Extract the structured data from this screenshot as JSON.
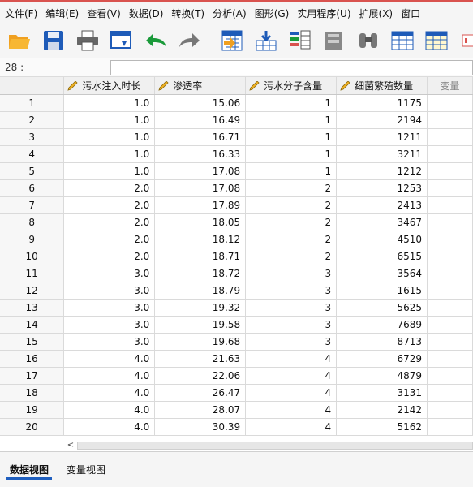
{
  "colors": {
    "accent": "#1f5fbf",
    "toolbar_bg": "#f5f5f5",
    "grid_line": "#dadada",
    "header_bg": "#f0f0f0"
  },
  "menu": {
    "items": [
      "文件(F)",
      "编辑(E)",
      "查看(V)",
      "数据(D)",
      "转换(T)",
      "分析(A)",
      "图形(G)",
      "实用程序(U)",
      "扩展(X)",
      "窗口"
    ]
  },
  "toolbar": {
    "icons": [
      "open-folder-icon",
      "save-icon",
      "print-icon",
      "dialog-recall-icon",
      "undo-icon",
      "redo-icon",
      "goto-case-icon",
      "goto-variable-icon",
      "variables-icon",
      "run-descriptives-icon",
      "find-icon",
      "insert-cases-icon",
      "insert-variable-icon",
      "split-file-icon"
    ]
  },
  "cellbar": {
    "ref": "28 :",
    "value": ""
  },
  "table": {
    "columns": [
      "污水注入时长",
      "渗透率",
      "污水分子含量",
      "细菌繁殖数量",
      "变量"
    ],
    "rows": [
      {
        "n": "1",
        "c1": "1.0",
        "c2": "15.06",
        "c3": "1",
        "c4": "1175"
      },
      {
        "n": "2",
        "c1": "1.0",
        "c2": "16.49",
        "c3": "1",
        "c4": "2194"
      },
      {
        "n": "3",
        "c1": "1.0",
        "c2": "16.71",
        "c3": "1",
        "c4": "1211"
      },
      {
        "n": "4",
        "c1": "1.0",
        "c2": "16.33",
        "c3": "1",
        "c4": "3211"
      },
      {
        "n": "5",
        "c1": "1.0",
        "c2": "17.08",
        "c3": "1",
        "c4": "1212"
      },
      {
        "n": "6",
        "c1": "2.0",
        "c2": "17.08",
        "c3": "2",
        "c4": "1253"
      },
      {
        "n": "7",
        "c1": "2.0",
        "c2": "17.89",
        "c3": "2",
        "c4": "2413"
      },
      {
        "n": "8",
        "c1": "2.0",
        "c2": "18.05",
        "c3": "2",
        "c4": "3467"
      },
      {
        "n": "9",
        "c1": "2.0",
        "c2": "18.12",
        "c3": "2",
        "c4": "4510"
      },
      {
        "n": "10",
        "c1": "2.0",
        "c2": "18.71",
        "c3": "2",
        "c4": "6515"
      },
      {
        "n": "11",
        "c1": "3.0",
        "c2": "18.72",
        "c3": "3",
        "c4": "3564"
      },
      {
        "n": "12",
        "c1": "3.0",
        "c2": "18.79",
        "c3": "3",
        "c4": "1615"
      },
      {
        "n": "13",
        "c1": "3.0",
        "c2": "19.32",
        "c3": "3",
        "c4": "5625"
      },
      {
        "n": "14",
        "c1": "3.0",
        "c2": "19.58",
        "c3": "3",
        "c4": "7689"
      },
      {
        "n": "15",
        "c1": "3.0",
        "c2": "19.68",
        "c3": "3",
        "c4": "8713"
      },
      {
        "n": "16",
        "c1": "4.0",
        "c2": "21.63",
        "c3": "4",
        "c4": "6729"
      },
      {
        "n": "17",
        "c1": "4.0",
        "c2": "22.06",
        "c3": "4",
        "c4": "4879"
      },
      {
        "n": "18",
        "c1": "4.0",
        "c2": "26.47",
        "c3": "4",
        "c4": "3131"
      },
      {
        "n": "19",
        "c1": "4.0",
        "c2": "28.07",
        "c3": "4",
        "c4": "2142"
      },
      {
        "n": "20",
        "c1": "4.0",
        "c2": "30.39",
        "c3": "4",
        "c4": "5162"
      }
    ]
  },
  "scrollbar": {
    "left_arrow": "<"
  },
  "tabs": [
    {
      "label": "数据视图",
      "active": true
    },
    {
      "label": "变量视图",
      "active": false
    }
  ]
}
